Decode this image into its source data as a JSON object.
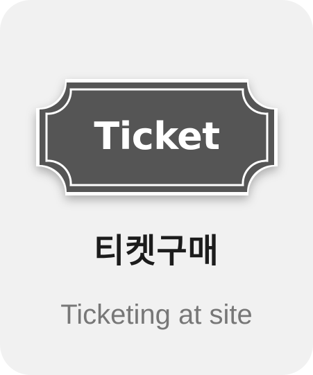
{
  "card": {
    "ticket_label": "Ticket",
    "title": "티켓구매",
    "subtitle": "Ticketing at site"
  },
  "colors": {
    "card_background": "#f1f1f1",
    "ticket_fill": "#555555",
    "ticket_border": "#ffffff",
    "title_text": "#1c1c1c",
    "subtitle_text": "#777777"
  },
  "icons": {
    "ticket": "ticket-icon"
  }
}
